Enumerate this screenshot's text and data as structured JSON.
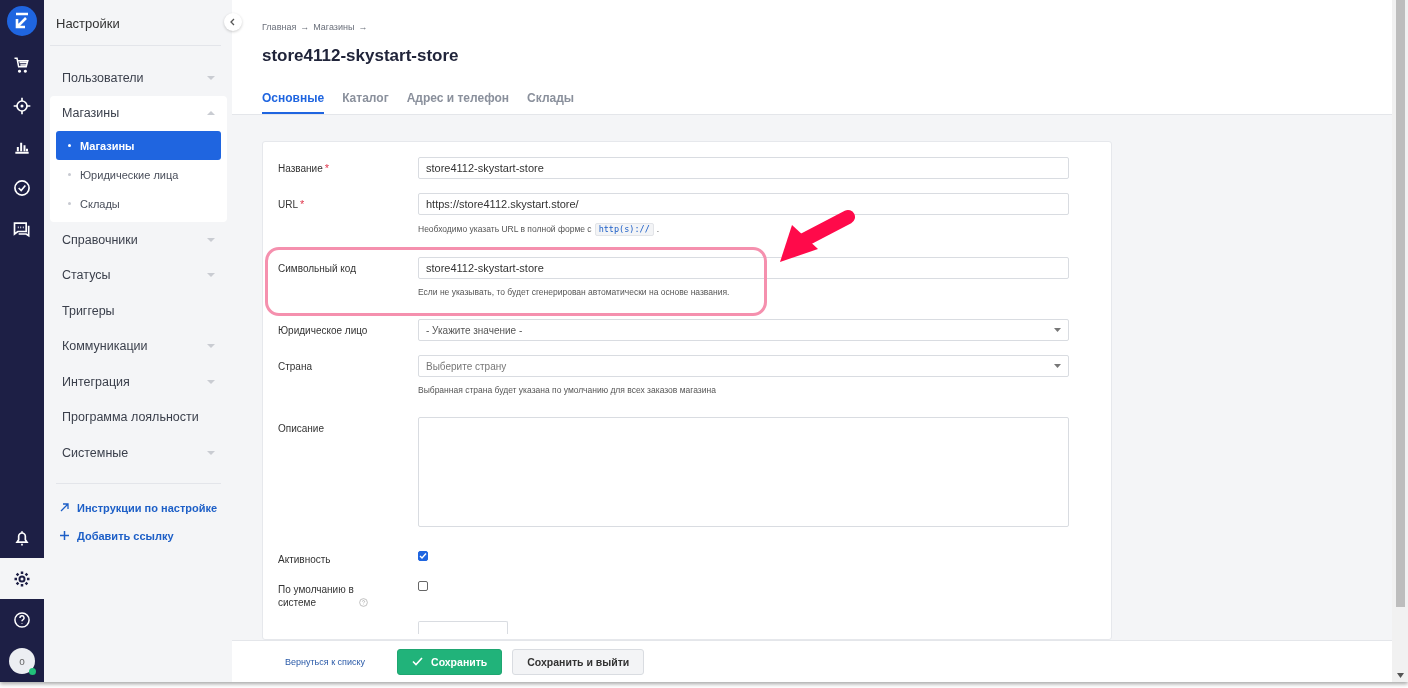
{
  "rail": {
    "top_items": [
      {
        "selected": false
      },
      {
        "selected": false
      },
      {
        "selected": false
      },
      {
        "selected": false
      },
      {
        "selected": false
      }
    ],
    "bottom_items": [
      {
        "selected": false
      },
      {
        "selected": true
      },
      {
        "selected": false
      }
    ],
    "avatar": {
      "initial": "o",
      "online": true
    }
  },
  "sidebar": {
    "title": "Настройки",
    "groups": [
      {
        "label": "Пользователи",
        "expandable": true,
        "expanded": false
      },
      {
        "label": "Магазины",
        "expandable": true,
        "expanded": true,
        "children": [
          {
            "label": "Магазины",
            "selected": true
          },
          {
            "label": "Юридические лица",
            "selected": false
          },
          {
            "label": "Склады",
            "selected": false
          }
        ]
      },
      {
        "label": "Справочники",
        "expandable": true,
        "expanded": false
      },
      {
        "label": "Статусы",
        "expandable": true,
        "expanded": false
      },
      {
        "label": "Триггеры",
        "expandable": false,
        "expanded": false
      },
      {
        "label": "Коммуникации",
        "expandable": true,
        "expanded": false
      },
      {
        "label": "Интеграция",
        "expandable": true,
        "expanded": false
      },
      {
        "label": "Программа лояльности",
        "expandable": false,
        "expanded": false
      },
      {
        "label": "Системные",
        "expandable": true,
        "expanded": false
      }
    ],
    "links": [
      {
        "kind": "external",
        "label": "Инструкции по настройке"
      },
      {
        "kind": "add",
        "label": "Добавить ссылку"
      }
    ]
  },
  "header": {
    "breadcrumb": [
      {
        "label": "Главная"
      },
      {
        "label": "Магазины"
      }
    ],
    "breadcrumb_separator": "→",
    "title": "store4112-skystart-store",
    "tabs": [
      {
        "label": "Основные",
        "selected": true
      },
      {
        "label": "Каталог",
        "selected": false
      },
      {
        "label": "Адрес и телефон",
        "selected": false
      },
      {
        "label": "Склады",
        "selected": false
      }
    ]
  },
  "form": {
    "fields": [
      {
        "kind": "text",
        "label": "Название",
        "required_mark": "*",
        "value": "store4112-skystart-store"
      },
      {
        "kind": "text",
        "label": "URL",
        "required_mark": "*",
        "value": "https://store4112.skystart.store/",
        "hint": "Необходимо указать URL в полной форме с",
        "hint_code": "http(s)://",
        "hint_end": "."
      },
      {
        "kind": "text",
        "label": "Символьный код",
        "value": "store4112-skystart-store",
        "hint": "Если не указывать, то будет сгенерирован автоматически на основе названия."
      },
      {
        "kind": "select",
        "label": "Юридическое лицо",
        "value": "- Укажите значение -"
      },
      {
        "kind": "select",
        "label": "Страна",
        "placeholder": "Выберите страну",
        "hint": "Выбранная страна будет указана по умолчанию для всех заказов магазина"
      },
      {
        "kind": "textarea",
        "label": "Описание"
      },
      {
        "kind": "checkbox",
        "label": "Активность",
        "checked": true
      },
      {
        "kind": "checkbox",
        "label": "По умолчанию в системе",
        "checked": false,
        "help": true
      },
      {
        "kind": "partial"
      }
    ]
  },
  "footer": {
    "back_link": "Вернуться к списку",
    "buttons": [
      {
        "kind": "primary",
        "label": "Сохранить"
      },
      {
        "kind": "secondary",
        "label": "Сохранить и выйти"
      }
    ]
  }
}
